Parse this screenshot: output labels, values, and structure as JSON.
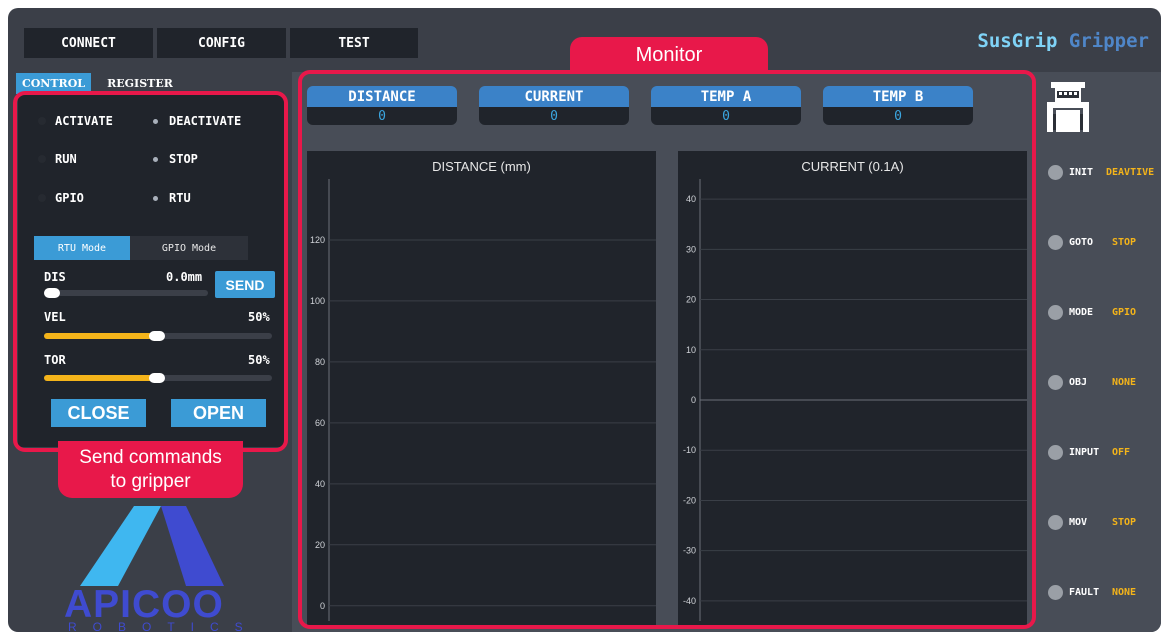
{
  "nav": {
    "connect": "CONNECT",
    "config": "CONFIG",
    "test": "TEST",
    "brand_1": "SusGrip",
    "brand_2": "Gripper"
  },
  "left_tabs": {
    "control": "CONTROL",
    "register": "REGISTER"
  },
  "control": {
    "activate": "ACTIVATE",
    "deactivate": "DEACTIVATE",
    "run": "RUN",
    "stop": "STOP",
    "gpio": "GPIO",
    "rtu": "RTU",
    "rtu_mode": "RTU Mode",
    "gpio_mode": "GPIO Mode",
    "dis_label": "DIS",
    "dis_value": "0.0mm",
    "dis_level": 0.0,
    "send": "SEND",
    "vel_label": "VEL",
    "vel_value": "50%",
    "vel_level": 0.5,
    "tor_label": "TOR",
    "tor_value": "50%",
    "tor_level": 0.5,
    "close": "CLOSE",
    "open": "OPEN"
  },
  "annotations": {
    "left": "Send commands\nto gripper",
    "monitor": "Monitor"
  },
  "logo": {
    "name": "APICOO",
    "sub": "ROBOTICS"
  },
  "metrics": [
    {
      "label": "DISTANCE",
      "value": "0"
    },
    {
      "label": "CURRENT",
      "value": "0"
    },
    {
      "label": "TEMP A",
      "value": "0"
    },
    {
      "label": "TEMP B",
      "value": "0"
    }
  ],
  "chart_data": [
    {
      "type": "line",
      "title": "DISTANCE (mm)",
      "xlabel": "",
      "ylabel": "",
      "ylim": [
        -5,
        140
      ],
      "yticks": [
        "0",
        "20",
        "40",
        "60",
        "80",
        "100",
        "120"
      ],
      "grid": true,
      "series": []
    },
    {
      "type": "line",
      "title": "CURRENT (0.1A)",
      "xlabel": "",
      "ylabel": "",
      "ylim": [
        -44,
        44
      ],
      "yticks": [
        "-40",
        "-30",
        "-20",
        "-10",
        "0",
        "10",
        "20",
        "30",
        "40"
      ],
      "grid": true,
      "series": []
    }
  ],
  "status": [
    {
      "label": "INIT",
      "value": "DEAVTIVE"
    },
    {
      "label": "GOTO",
      "value": "STOP"
    },
    {
      "label": "MODE",
      "value": "GPIO"
    },
    {
      "label": "OBJ",
      "value": "NONE"
    },
    {
      "label": "INPUT",
      "value": "OFF"
    },
    {
      "label": "MOV",
      "value": "STOP"
    },
    {
      "label": "FAULT",
      "value": "NONE"
    }
  ],
  "icons": {
    "gripper": "gripper-icon"
  },
  "colors": {
    "accent": "#3b9bd6",
    "highlight": "#e8184a",
    "slider": "#f4b41a",
    "value": "#3ba6e0"
  }
}
